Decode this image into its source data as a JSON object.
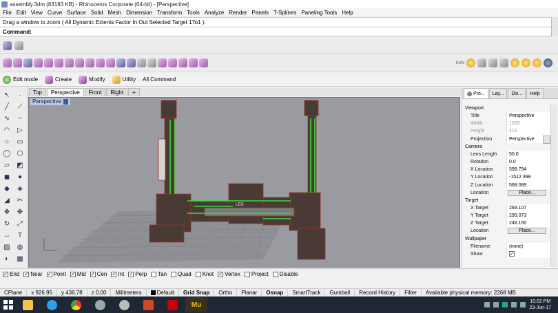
{
  "window": {
    "title": "assembly.3dm (83183 KB) - Rhinoceros Corporate (64-bit) - [Perspective]"
  },
  "menu": [
    "File",
    "Edit",
    "View",
    "Curve",
    "Surface",
    "Solid",
    "Mesh",
    "Dimension",
    "Transform",
    "Tools",
    "Analyze",
    "Render",
    "Panels",
    "T-Splines",
    "Paneling Tools",
    "Help"
  ],
  "command": {
    "history": "Drag a window to zoom ( All  Dynamic  Extents  Factor  In  Out  Selected  Target  1To1 ):",
    "prompt": "Command:"
  },
  "toolbar3": {
    "edit_mode": "Edit mode",
    "create": "Create",
    "modify": "Modify",
    "utility": "Utility",
    "all_command": "All Command"
  },
  "toolbar2": {
    "sun_label": "SUN"
  },
  "viewport_tabs": [
    "Top",
    "Perspective",
    "Front",
    "Right",
    "+"
  ],
  "viewport": {
    "label": "Perspective",
    "model_label": "LED"
  },
  "panel_tabs": [
    "Pro...",
    "Lay...",
    "Dis...",
    "Help"
  ],
  "properties": {
    "viewport_section": "Viewport",
    "title_k": "Title",
    "title_v": "Perspective",
    "width_k": "Width",
    "width_v": "1055",
    "height_k": "Height",
    "height_v": "415",
    "projection_k": "Projection",
    "projection_v": "Perspective",
    "camera_section": "Camera",
    "lens_k": "Lens Length",
    "lens_v": "50.0",
    "rotation_k": "Rotation",
    "rotation_v": "0.0",
    "xloc_k": "X Location",
    "xloc_v": "598.794",
    "yloc_k": "Y Location",
    "yloc_v": "-1512.398",
    "zloc_k": "Z Location",
    "zloc_v": "568.089",
    "location_k": "Location",
    "place_btn": "Place...",
    "target_section": "Target",
    "xt_k": "X Target",
    "xt_v": "293.107",
    "yt_k": "Y Target",
    "yt_v": "295.073",
    "zt_k": "Z Target",
    "zt_v": "248.150",
    "tloc_k": "Location",
    "tplace_btn": "Place...",
    "wallpaper_section": "Wallpaper",
    "filename_k": "Filename",
    "filename_v": "(none)",
    "show_k": "Show"
  },
  "osnap": [
    "End",
    "Near",
    "Point",
    "Mid",
    "Cen",
    "Int",
    "Perp",
    "Tan",
    "Quad",
    "Knot",
    "Vertex",
    "Project",
    "Disable"
  ],
  "osnap_checked": [
    true,
    true,
    true,
    true,
    true,
    true,
    true,
    false,
    false,
    false,
    true,
    false,
    false
  ],
  "status": {
    "cplane": "CPlane",
    "x": "x 926.95",
    "y": "y 436.78",
    "z": "z 0.00",
    "units": "Millimeters",
    "layer": "Default",
    "grid_snap": "Grid Snap",
    "ortho": "Ortho",
    "planar": "Planar",
    "osnap": "Osnap",
    "smarttrack": "SmartTrack",
    "gumball": "Gumball",
    "record_history": "Record History",
    "filter": "Filter",
    "memory": "Available physical memory: 2268 MB"
  },
  "taskbar": {
    "time": "10:02 PM",
    "date": "23-Jun-17",
    "mu_label": "Mu"
  }
}
